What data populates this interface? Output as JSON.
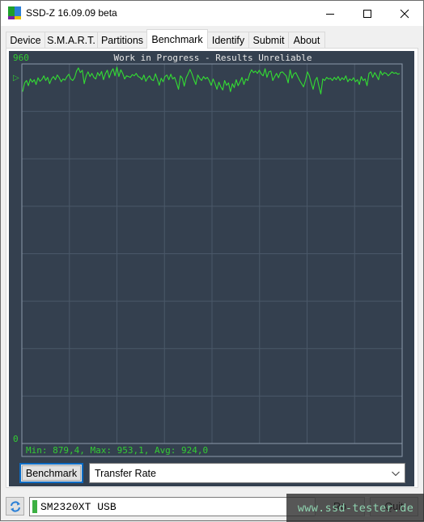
{
  "window": {
    "title": "SSD-Z 16.09.09 beta",
    "controls": {
      "minimize": "minimize",
      "maximize": "maximize",
      "close": "close"
    }
  },
  "tabs": [
    {
      "label": "Device",
      "active": false
    },
    {
      "label": "S.M.A.R.T.",
      "active": false
    },
    {
      "label": "Partitions",
      "active": false
    },
    {
      "label": "Benchmark",
      "active": true
    },
    {
      "label": "Identify",
      "active": false
    },
    {
      "label": "Submit",
      "active": false
    },
    {
      "label": "About",
      "active": false
    }
  ],
  "benchmark": {
    "button_label": "Benchmark",
    "mode_selected": "Transfer Rate",
    "stats_text": "Min: 879,4, Max: 953,1, Avg: 924,0"
  },
  "status": {
    "drive_name": "SM2320XT USB",
    "drive_led_color": "#3cb043",
    "button_ro_label": "Ro",
    "button_quit_label": "Quit",
    "watermark": "www.ssd-tester.de"
  },
  "colors": {
    "graph_bg": "#34404f",
    "graph_line": "#33dd33",
    "grid": "#4a5869",
    "axis": "#8d9aab",
    "label_green": "#33cc33"
  },
  "chart_data": {
    "type": "line",
    "title": "Work in Progress - Results Unreliable",
    "ylabel_top": "960",
    "ylabel_bottom": "0",
    "marker": "▷",
    "ylim": [
      0,
      960
    ],
    "grid": true,
    "x_divisions": 8,
    "y_divisions": 8,
    "stats": {
      "min": 879.4,
      "max": 953.1,
      "avg": 924.0
    },
    "series": [
      {
        "name": "Transfer Rate",
        "values": [
          890,
          912,
          918,
          905,
          922,
          914,
          920,
          908,
          925,
          916,
          921,
          930,
          918,
          926,
          910,
          922,
          928,
          920,
          932,
          925,
          915,
          922,
          919,
          928,
          934,
          922,
          918,
          925,
          942,
          950,
          938,
          944,
          910,
          930,
          940,
          928,
          936,
          926,
          922,
          938,
          930,
          941,
          920,
          935,
          944,
          925,
          940,
          948,
          930,
          952,
          928,
          945,
          936,
          922,
          930,
          928,
          926,
          933,
          930,
          936,
          928,
          926,
          920,
          932,
          916,
          925,
          930,
          920,
          918,
          935,
          922,
          906,
          924,
          915,
          928,
          932,
          920,
          934,
          922,
          926,
          912,
          896,
          930,
          924,
          904,
          925,
          935,
          946,
          935,
          920,
          908,
          932,
          924,
          918,
          928,
          922,
          926,
          918,
          906,
          922,
          910,
          896,
          914,
          902,
          894,
          918,
          906,
          912,
          890,
          910,
          900,
          920,
          905,
          915,
          926,
          908,
          922,
          918,
          935,
          945,
          938,
          942,
          936,
          944,
          935,
          930,
          948,
          926,
          940,
          942,
          918,
          928,
          936,
          925,
          938,
          940,
          935,
          930,
          912,
          945,
          924,
          935,
          938,
          928,
          918,
          910,
          902,
          918,
          940,
          930,
          912,
          896,
          918,
          926,
          904,
          884,
          922,
          918,
          926,
          922,
          924,
          918,
          926,
          920,
          928,
          918,
          925,
          920,
          930,
          915,
          922,
          918,
          925,
          915,
          920,
          908,
          928,
          918,
          922,
          905,
          936,
          940,
          926,
          938,
          930,
          920,
          942,
          932,
          938,
          936,
          930,
          935,
          940,
          936,
          938,
          934,
          936
        ]
      }
    ]
  }
}
